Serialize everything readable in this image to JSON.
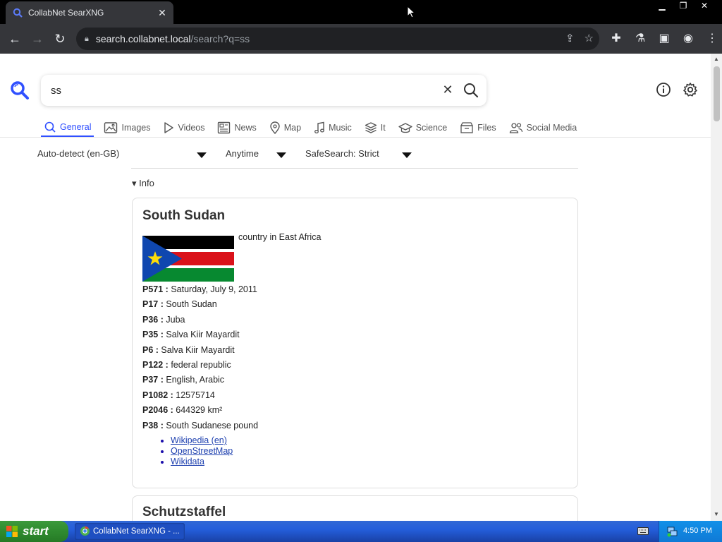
{
  "browser": {
    "tab_title": "CollabNet SearXNG",
    "tab_close": "✕",
    "url_host": "search.collabnet.local",
    "url_path": "/search?q=ss"
  },
  "search": {
    "query": "ss",
    "clear": "✕"
  },
  "categories": [
    {
      "label": "General",
      "icon": "search-icon",
      "active": true
    },
    {
      "label": "Images",
      "icon": "image-icon"
    },
    {
      "label": "Videos",
      "icon": "play-icon"
    },
    {
      "label": "News",
      "icon": "newspaper-icon"
    },
    {
      "label": "Map",
      "icon": "map-pin-icon"
    },
    {
      "label": "Music",
      "icon": "music-note-icon"
    },
    {
      "label": "It",
      "icon": "layers-icon"
    },
    {
      "label": "Science",
      "icon": "graduation-cap-icon"
    },
    {
      "label": "Files",
      "icon": "archive-icon"
    },
    {
      "label": "Social Media",
      "icon": "people-icon"
    }
  ],
  "filters": {
    "language": "Auto-detect (en-GB)",
    "time": "Anytime",
    "safesearch": "SafeSearch: Strict"
  },
  "info_toggle": "▾ Info",
  "infobox": {
    "title": "South Sudan",
    "description": "country in East Africa",
    "attributes": [
      {
        "key": "P571 :",
        "value": "Saturday, July 9, 2011"
      },
      {
        "key": "P17 :",
        "value": "South Sudan"
      },
      {
        "key": "P36 :",
        "value": "Juba"
      },
      {
        "key": "P35 :",
        "value": "Salva Kiir Mayardit"
      },
      {
        "key": "P6 :",
        "value": "Salva Kiir Mayardit"
      },
      {
        "key": "P122 :",
        "value": "federal republic"
      },
      {
        "key": "P37 :",
        "value": "English, Arabic"
      },
      {
        "key": "P1082 :",
        "value": "12575714"
      },
      {
        "key": "P2046 :",
        "value": "644329 km²"
      },
      {
        "key": "P38 :",
        "value": "South Sudanese pound"
      }
    ],
    "links": [
      "Wikipedia (en)",
      "OpenStreetMap",
      "Wikidata"
    ]
  },
  "infobox2": {
    "title": "Schutzstaffel"
  },
  "taskbar": {
    "start_label": "start",
    "task_label": "CollabNet SearXNG - ...",
    "clock": "4:50 PM"
  },
  "colors": {
    "accent": "#3050ff",
    "link": "#1e40af"
  }
}
